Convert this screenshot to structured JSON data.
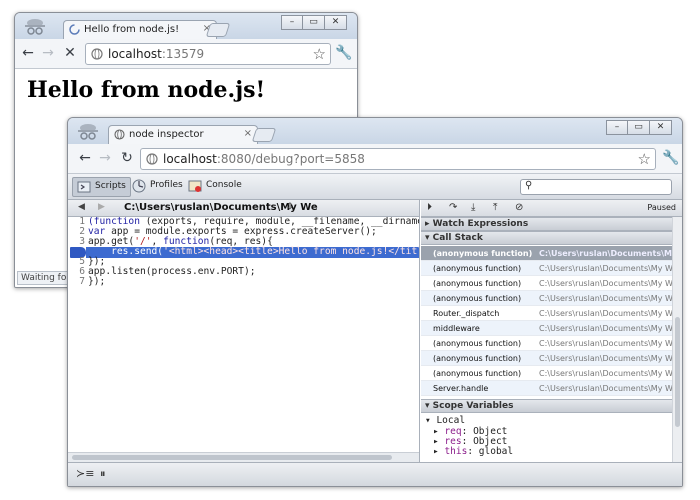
{
  "window1": {
    "tab_title": "Hello from node.js!",
    "tab_close": "×",
    "url_host": "localhost",
    "url_rest": ":13579",
    "heading": "Hello from node.js!",
    "status": "Waiting for"
  },
  "window2": {
    "tab_title": "node inspector",
    "tab_close": "×",
    "url_host": "localhost",
    "url_rest": ":8080/debug?port=5858",
    "devtools_tabs": [
      {
        "label": "Scripts",
        "icon": "scripts-icon"
      },
      {
        "label": "Profiles",
        "icon": "profiles-icon"
      },
      {
        "label": "Console",
        "icon": "console-icon"
      }
    ],
    "file_path": "C:\\Users\\ruslan\\Documents\\My We",
    "paused_label": "Paused",
    "code_lines": [
      {
        "n": "1",
        "text": "(function (exports, require, module, __filename, __dirname) { va"
      },
      {
        "n": "2",
        "text": "var app = module.exports = express.createServer();"
      },
      {
        "n": "3",
        "text": "app.get('/', function(req, res){"
      },
      {
        "n": "4",
        "text": "    res.send('<html><head><title>Hello from node.js!</title><lin"
      },
      {
        "n": "5",
        "text": "});"
      },
      {
        "n": "6",
        "text": "app.listen(process.env.PORT);"
      },
      {
        "n": "7",
        "text": "});"
      }
    ],
    "sections": {
      "watch": "Watch Expressions",
      "call_stack": "Call Stack",
      "scope": "Scope Variables"
    },
    "call_stack": [
      {
        "fn": "(anonymous function)",
        "loc": "C:\\Users\\ruslan\\Documents\\My We..."
      },
      {
        "fn": "(anonymous function)",
        "loc": "C:\\Users\\ruslan\\Documents\\My We..."
      },
      {
        "fn": "(anonymous function)",
        "loc": "C:\\Users\\ruslan\\Documents\\My We..."
      },
      {
        "fn": "(anonymous function)",
        "loc": "C:\\Users\\ruslan\\Documents\\My We..."
      },
      {
        "fn": "Router._dispatch",
        "loc": "C:\\Users\\ruslan\\Documents\\My We..."
      },
      {
        "fn": "middleware",
        "loc": "C:\\Users\\ruslan\\Documents\\My We..."
      },
      {
        "fn": "(anonymous function)",
        "loc": "C:\\Users\\ruslan\\Documents\\My We..."
      },
      {
        "fn": "(anonymous function)",
        "loc": "C:\\Users\\ruslan\\Documents\\My We..."
      },
      {
        "fn": "(anonymous function)",
        "loc": "C:\\Users\\ruslan\\Documents\\My We..."
      },
      {
        "fn": "Server.handle",
        "loc": "C:\\Users\\ruslan\\Documents\\My We..."
      }
    ],
    "scope": {
      "local_label": "Local",
      "vars": [
        {
          "name": "req",
          "value": "Object"
        },
        {
          "name": "res",
          "value": "Object"
        },
        {
          "name": "this",
          "value": "global"
        }
      ]
    }
  },
  "colors": {
    "highlight": "#3d6bd0",
    "selected_frame": "#9aa2ad"
  }
}
